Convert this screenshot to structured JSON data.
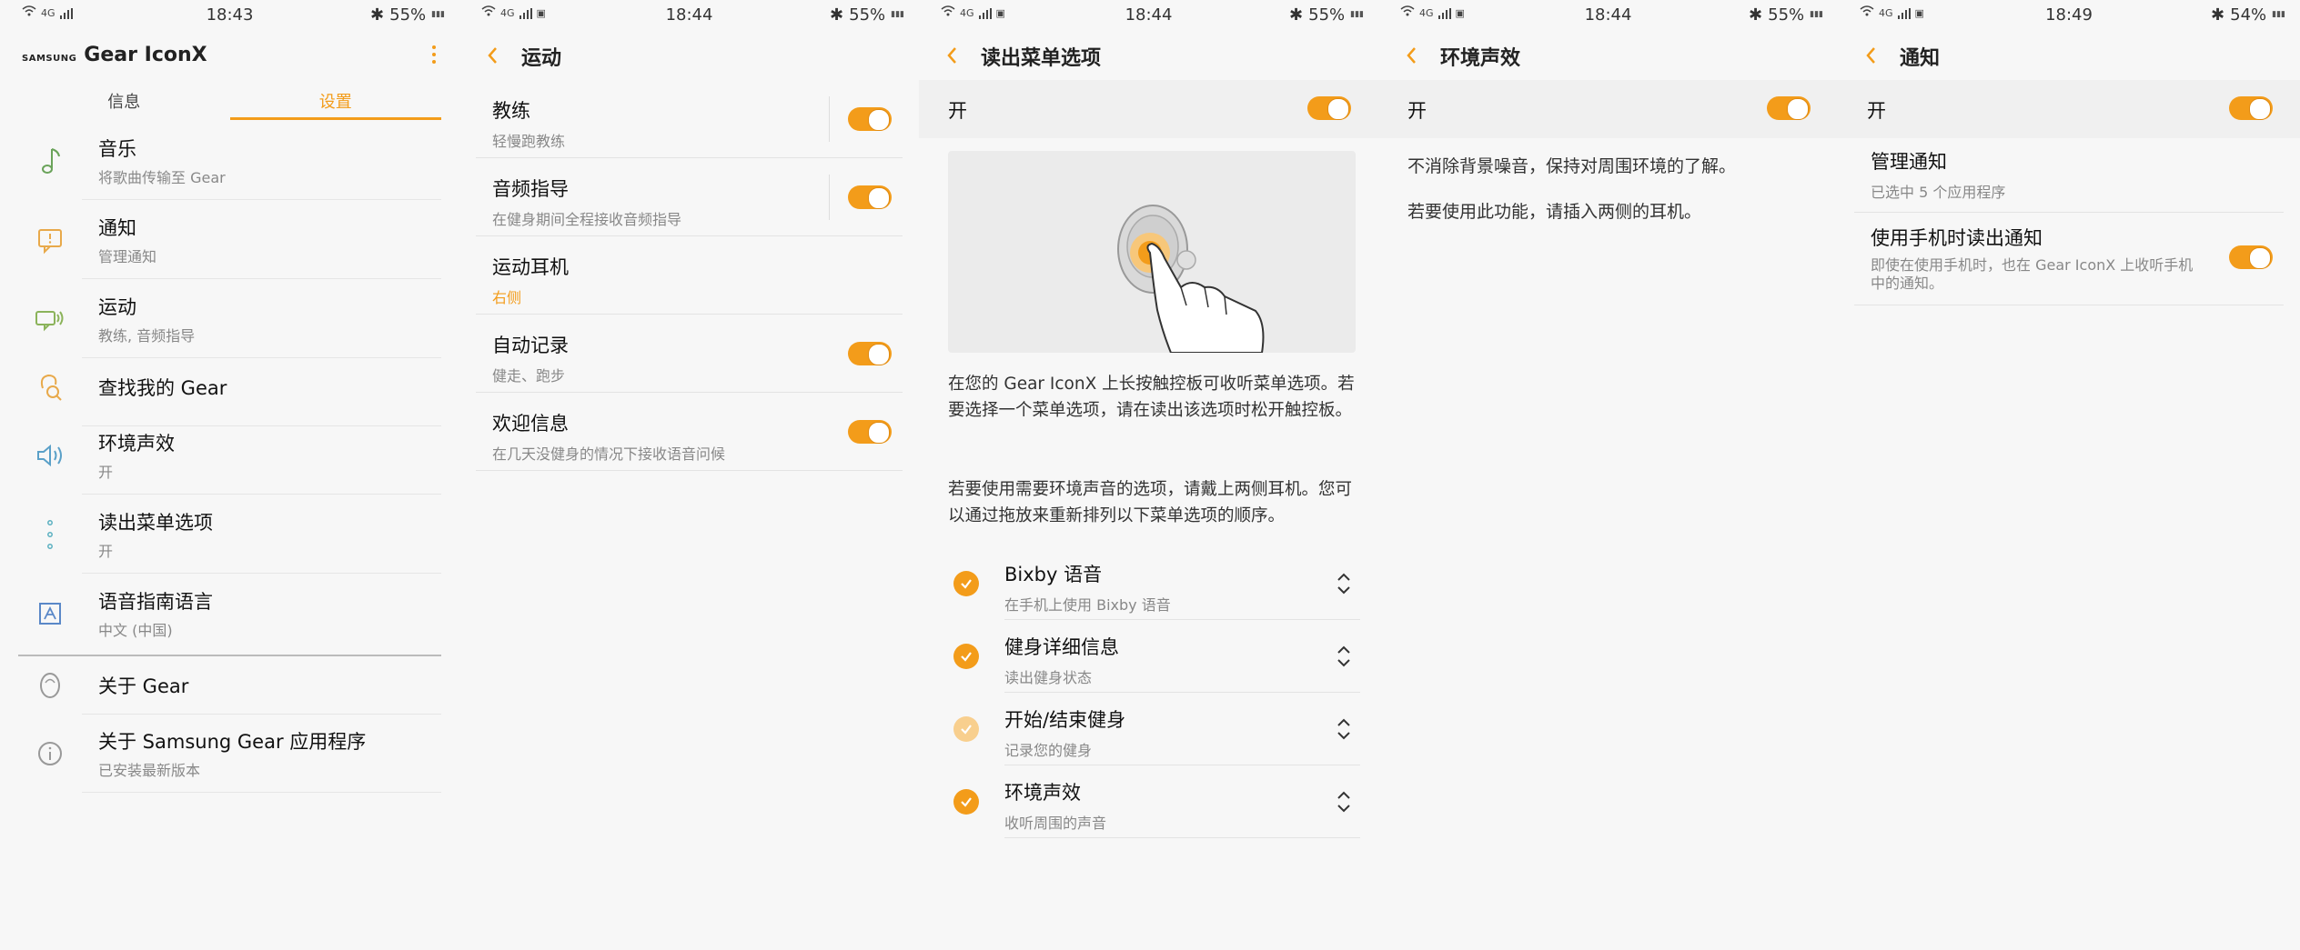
{
  "colors": {
    "accent": "#f39c1a",
    "background": "#f7f7f7"
  },
  "panel1": {
    "status": {
      "time": "18:43",
      "battery": "55%",
      "network": "4G"
    },
    "brand_small": "SAMSUNG",
    "brand_title": "Gear IconX",
    "tabs": [
      "信息",
      "设置"
    ],
    "items": [
      {
        "label": "音乐",
        "sub": "将歌曲传输至 Gear",
        "icon": "music-note-icon"
      },
      {
        "label": "通知",
        "sub": "管理通知",
        "icon": "notification-icon"
      },
      {
        "label": "运动",
        "sub": "教练, 音频指导",
        "icon": "workout-icon"
      },
      {
        "label": "查找我的 Gear",
        "sub": "",
        "icon": "find-gear-icon"
      },
      {
        "label": "环境声效",
        "sub": "开",
        "icon": "speaker-icon"
      },
      {
        "label": "读出菜单选项",
        "sub": "开",
        "icon": "menu-dots-icon"
      },
      {
        "label": "语音指南语言",
        "sub": "中文 (中国)",
        "icon": "language-icon"
      },
      {
        "label": "关于 Gear",
        "sub": "",
        "icon": "earbud-icon"
      },
      {
        "label": "关于 Samsung Gear 应用程序",
        "sub": "已安装最新版本",
        "icon": "info-icon"
      }
    ]
  },
  "panel2": {
    "status": {
      "time": "18:44",
      "battery": "55%",
      "network": "4G"
    },
    "title": "运动",
    "rows": [
      {
        "label": "教练",
        "sub": "轻慢跑教练"
      },
      {
        "label": "音频指导",
        "sub": "在健身期间全程接收音频指导"
      },
      {
        "label": "运动耳机",
        "sub": "右侧"
      },
      {
        "label": "自动记录",
        "sub": "健走、跑步"
      },
      {
        "label": "欢迎信息",
        "sub": "在几天没健身的情况下接收语音问候"
      }
    ]
  },
  "panel3": {
    "status": {
      "time": "18:44",
      "battery": "55%",
      "network": "4G"
    },
    "title": "读出菜单选项",
    "on_label": "开",
    "para1": "在您的 Gear IconX 上长按触控板可收听菜单选项。若要选择一个菜单选项，请在读出该选项时松开触控板。",
    "para2": "若要使用需要环境声音的选项，请戴上两侧耳机。您可以通过拖放来重新排列以下菜单选项的顺序。",
    "options": [
      {
        "label": "Bixby 语音",
        "sub": "在手机上使用 Bixby 语音",
        "checked": true
      },
      {
        "label": "健身详细信息",
        "sub": "读出健身状态",
        "checked": true
      },
      {
        "label": "开始/结束健身",
        "sub": "记录您的健身",
        "checked": true
      },
      {
        "label": "环境声效",
        "sub": "收听周围的声音",
        "checked": true
      }
    ]
  },
  "panel4": {
    "status": {
      "time": "18:44",
      "battery": "55%",
      "network": "4G"
    },
    "title": "环境声效",
    "on_label": "开",
    "line1": "不消除背景噪音，保持对周围环境的了解。",
    "line2": "若要使用此功能，请插入两侧的耳机。"
  },
  "panel5": {
    "status": {
      "time": "18:49",
      "battery": "54%",
      "network": "4G"
    },
    "title": "通知",
    "on_label": "开",
    "rows": [
      {
        "label": "管理通知",
        "sub": "已选中 5 个应用程序"
      },
      {
        "label": "使用手机时读出通知",
        "sub": "即使在使用手机时，也在 Gear IconX 上收听手机中的通知。"
      }
    ]
  }
}
